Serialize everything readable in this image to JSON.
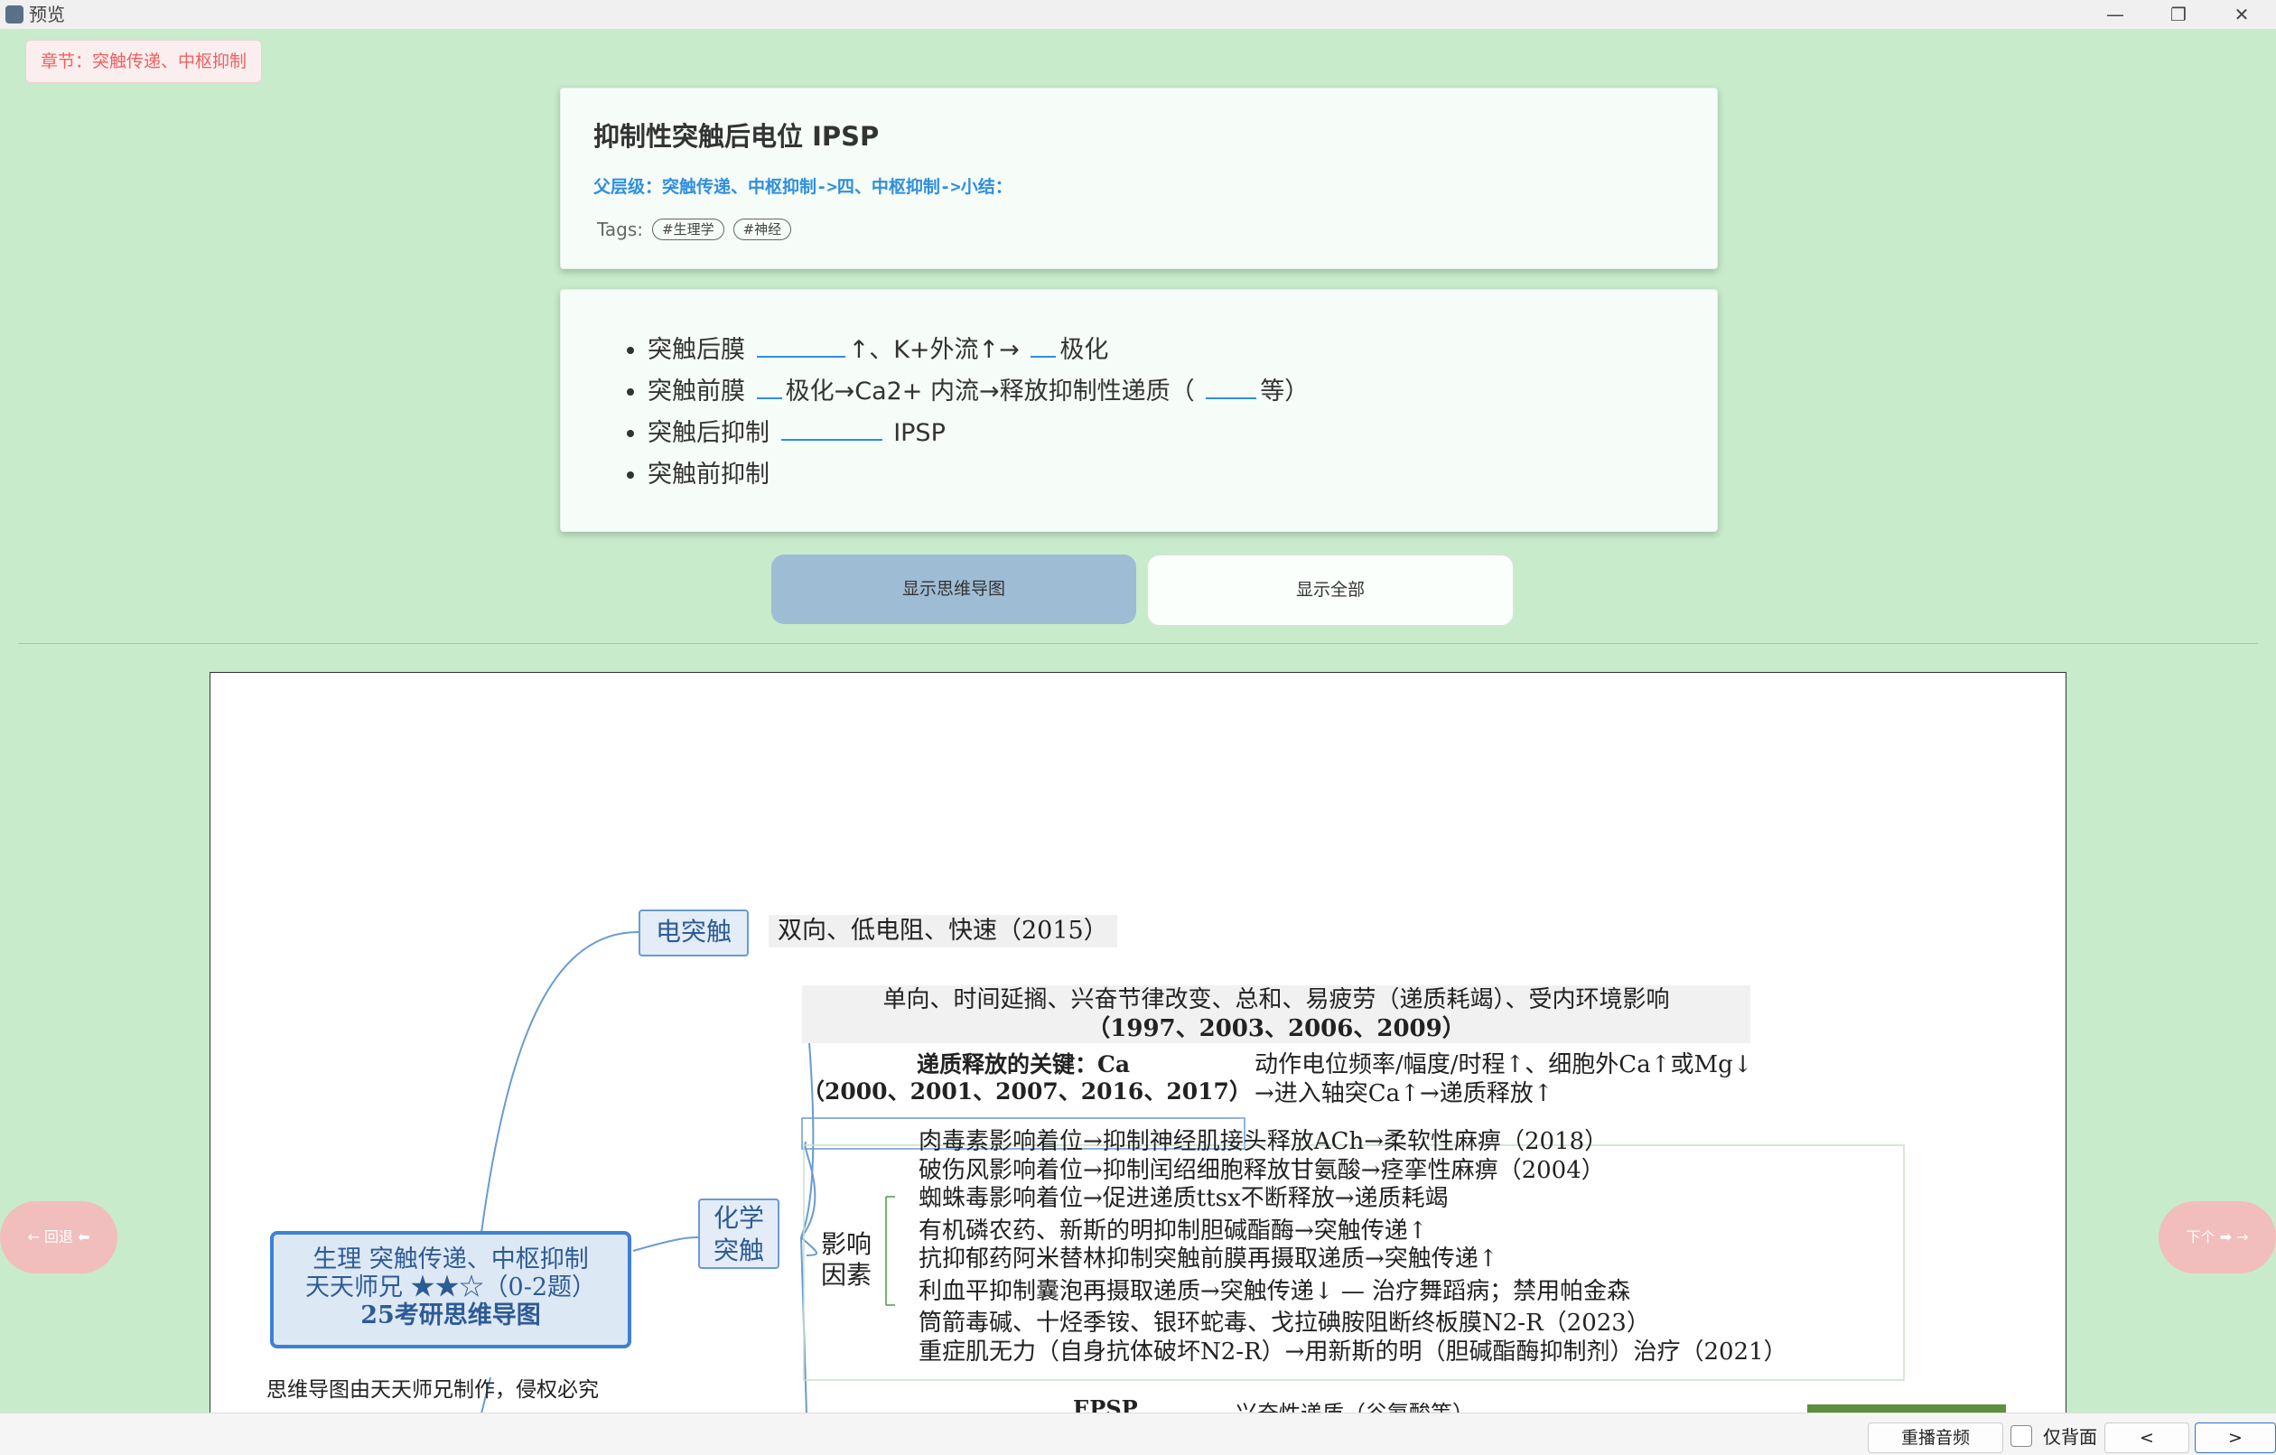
{
  "window": {
    "title": "预览",
    "minimize": "—",
    "maximize": "❐",
    "close": "✕"
  },
  "chapter": "章节：突触传递、中枢抑制",
  "header": {
    "title": "抑制性突触后电位 IPSP",
    "parent_path": "父层级：突触传递、中枢抑制->四、中枢抑制->小结：",
    "tags_label": "Tags:",
    "tags": [
      "#生理学",
      "#神经"
    ]
  },
  "content": {
    "items": [
      {
        "before": "突触后膜",
        "blank_width": "short",
        "after": "↑、K+外流↑→",
        "blank2": true,
        "after2": "极化"
      },
      {
        "before": "突触前膜",
        "after": "极化→Ca2+ 内流→释放抑制性递质（",
        "after2": "等）"
      },
      {
        "before": "突触后抑制",
        "after": "IPSP"
      },
      {
        "before": "突触前抑制"
      }
    ]
  },
  "buttons": {
    "mindmap": "显示思维导图",
    "all": "显示全部"
  },
  "mindmap": {
    "root": [
      "生理 突触传递、中枢抑制",
      "天天师兄 ★★☆（0-2题）",
      "25考研思维导图"
    ],
    "copyright": "思维导图由天天师兄制作，侵权必究",
    "electric": {
      "label": "电突触",
      "detail": "双向、低电阻、快速（2015）"
    },
    "chemical": {
      "label": [
        "化学",
        "突触"
      ],
      "feature1": "单向、时间延搁、兴奋节律改变、总和、易疲劳（递质耗竭）、受内环境影响",
      "feature2": "（1997、2003、2006、2009）",
      "key1": "递质释放的关键：Ca",
      "key2": "（2000、2001、2007、2016、2017）",
      "ap1": "动作电位频率/幅度/时程↑、细胞外Ca↑或Mg↓",
      "ap2": "→进入轴突Ca↑→递质释放↑",
      "factors_label": [
        "影响",
        "因素"
      ],
      "factors": [
        "肉毒素影响着位→抑制神经肌接头释放ACh→柔软性麻痹（2018）",
        "破伤风影响着位→抑制闰绍细胞释放甘氨酸→痉挛性麻痹（2004）",
        "蜘蛛毒影响着位→促进递质ttsx不断释放→递质耗竭",
        "有机磷农药、新斯的明抑制胆碱酯酶→突触传递↑",
        "抗抑郁药阿米替林抑制突触前膜再摄取递质→突触传递↑",
        "利血平抑制囊泡再摄取递质→突触传递↓ — 治疗舞蹈病；禁用帕金森",
        "筒箭毒碱、十烃季铵、银环蛇毒、戈拉碘胺阻断终板膜N2-R（2023）",
        "重症肌无力（自身抗体破坏N2-R）→用新斯的明（胆碱酯酶抑制剂）治疗（2021）"
      ],
      "epsp": "EPSP",
      "epsp_detail": "兴奋性递质（谷氨酸等）"
    }
  },
  "nav": {
    "prev": "← 回退 ⬅",
    "next": "下个 ➡ →"
  },
  "bottom": {
    "replay": "重播音频",
    "back_only": "仅背面",
    "prev": "<",
    "next": ">"
  }
}
